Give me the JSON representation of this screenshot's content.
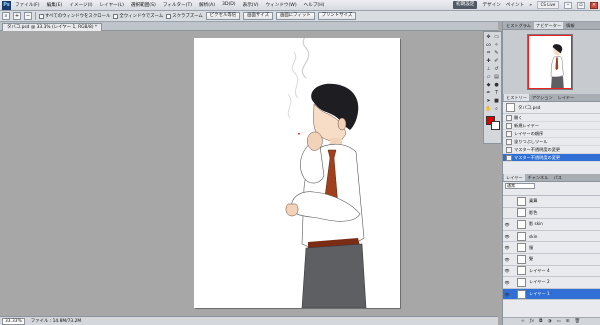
{
  "menubar": {
    "logo": "Ps",
    "items": [
      "ファイル(F)",
      "編集(E)",
      "イメージ(I)",
      "レイヤー(L)",
      "選択範囲(S)",
      "フィルター(T)",
      "解析(A)",
      "3D(D)",
      "表示(V)",
      "ウィンドウ(W)",
      "ヘルプ(H)"
    ],
    "right": {
      "essentials": "初期設定",
      "design": "デザイン",
      "paint": "ペイント",
      "more": "»",
      "cslive": "CS Live"
    }
  },
  "options": {
    "check1": "すべてのウィンドウをスクロール",
    "check2": "全ウィンドウでズーム",
    "check3": "スクラブズーム",
    "btn1": "ピクセル等倍",
    "btn2": "画面サイズ",
    "btn3": "画面にフィット",
    "btn4": "プリントサイズ"
  },
  "document_tab": "タバコ.psd @ 33.3% (レイヤー 1, RGB/8) *",
  "status": {
    "zoom": "33.33%",
    "info": "ファイル : 14.8M/73.2M"
  },
  "history": {
    "snapshot": "タバコ.psd",
    "items": [
      "開く",
      "新規レイヤー",
      "レイヤーの順序",
      "塗りつぶしツール",
      "マスター不透明度の変更",
      "マスター不透明度の変更"
    ],
    "active_index": 5
  },
  "panel_tabs": {
    "top": [
      "ヒストグラム",
      "ナビゲーター",
      "情報"
    ],
    "top_active": 1,
    "mid": [
      "ヒストリー",
      "アクション",
      "レイヤー"
    ],
    "mid_active": 0,
    "bottom": [
      "レイヤー",
      "チャンネル",
      "パス"
    ],
    "bottom_active": 0
  },
  "layers": {
    "blend_mode": "通常",
    "rows": [
      {
        "name": "乗算",
        "visible": false,
        "active": false
      },
      {
        "name": "影色",
        "visible": false,
        "active": false
      },
      {
        "name": "影 skin",
        "visible": true,
        "active": false
      },
      {
        "name": "skin",
        "visible": true,
        "active": false
      },
      {
        "name": "服",
        "visible": true,
        "active": false
      },
      {
        "name": "髪",
        "visible": true,
        "active": false
      },
      {
        "name": "レイヤー 4",
        "visible": true,
        "active": false
      },
      {
        "name": "レイヤー 2",
        "visible": true,
        "active": false
      },
      {
        "name": "レイヤー 1",
        "visible": true,
        "active": true
      }
    ]
  },
  "colors": {
    "foreground": "#e00000",
    "background": "#ffffff",
    "selection": "#2f6fd6"
  }
}
